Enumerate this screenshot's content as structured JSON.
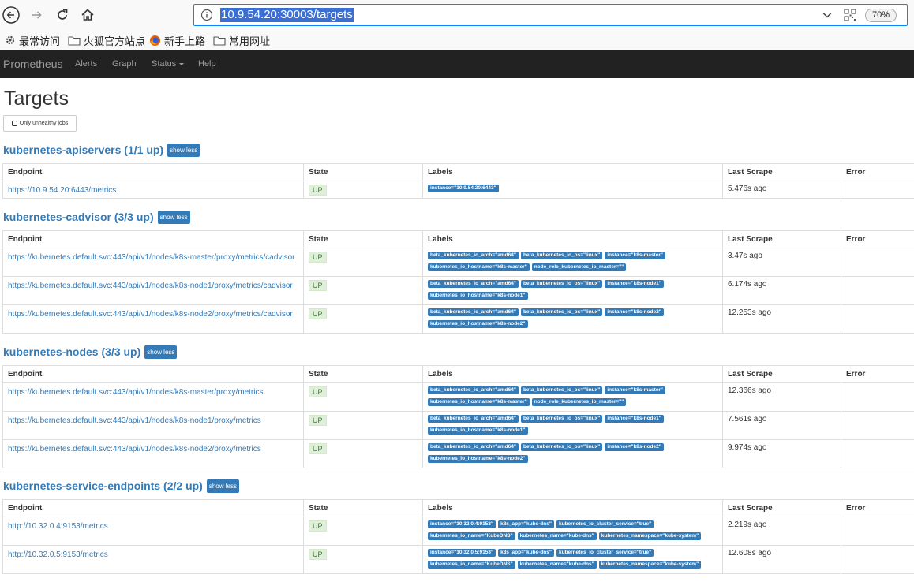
{
  "browser": {
    "url": "10.9.54.20:30003/targets",
    "zoom": "70%",
    "bookmarks": [
      "最常访问",
      "火狐官方站点",
      "新手上路",
      "常用网址"
    ]
  },
  "nav": {
    "brand": "Prometheus",
    "links": [
      "Alerts",
      "Graph",
      "Status",
      "Help"
    ]
  },
  "page": {
    "title": "Targets",
    "unhealthy_btn": "Only unhealthy jobs",
    "columns": [
      "Endpoint",
      "State",
      "Labels",
      "Last Scrape",
      "Error"
    ]
  },
  "jobs": [
    {
      "name": "kubernetes-apiservers (1/1 up)",
      "toggle": "show less",
      "targets": [
        {
          "endpoint": "https://10.9.54.20:6443/metrics",
          "state": "UP",
          "labels": [
            "instance=\"10.9.54.20:6443\""
          ],
          "last_scrape": "5.476s ago",
          "error": ""
        }
      ]
    },
    {
      "name": "kubernetes-cadvisor (3/3 up)",
      "toggle": "show less",
      "targets": [
        {
          "endpoint": "https://kubernetes.default.svc:443/api/v1/nodes/k8s-master/proxy/metrics/cadvisor",
          "state": "UP",
          "labels": [
            "beta_kubernetes_io_arch=\"amd64\"",
            "beta_kubernetes_io_os=\"linux\"",
            "instance=\"k8s-master\"",
            "kubernetes_io_hostname=\"k8s-master\"",
            "node_role_kubernetes_io_master=\"\""
          ],
          "last_scrape": "3.47s ago",
          "error": ""
        },
        {
          "endpoint": "https://kubernetes.default.svc:443/api/v1/nodes/k8s-node1/proxy/metrics/cadvisor",
          "state": "UP",
          "labels": [
            "beta_kubernetes_io_arch=\"amd64\"",
            "beta_kubernetes_io_os=\"linux\"",
            "instance=\"k8s-node1\"",
            "kubernetes_io_hostname=\"k8s-node1\""
          ],
          "last_scrape": "6.174s ago",
          "error": ""
        },
        {
          "endpoint": "https://kubernetes.default.svc:443/api/v1/nodes/k8s-node2/proxy/metrics/cadvisor",
          "state": "UP",
          "labels": [
            "beta_kubernetes_io_arch=\"amd64\"",
            "beta_kubernetes_io_os=\"linux\"",
            "instance=\"k8s-node2\"",
            "kubernetes_io_hostname=\"k8s-node2\""
          ],
          "last_scrape": "12.253s ago",
          "error": ""
        }
      ]
    },
    {
      "name": "kubernetes-nodes (3/3 up)",
      "toggle": "show less",
      "targets": [
        {
          "endpoint": "https://kubernetes.default.svc:443/api/v1/nodes/k8s-master/proxy/metrics",
          "state": "UP",
          "labels": [
            "beta_kubernetes_io_arch=\"amd64\"",
            "beta_kubernetes_io_os=\"linux\"",
            "instance=\"k8s-master\"",
            "kubernetes_io_hostname=\"k8s-master\"",
            "node_role_kubernetes_io_master=\"\""
          ],
          "last_scrape": "12.366s ago",
          "error": ""
        },
        {
          "endpoint": "https://kubernetes.default.svc:443/api/v1/nodes/k8s-node1/proxy/metrics",
          "state": "UP",
          "labels": [
            "beta_kubernetes_io_arch=\"amd64\"",
            "beta_kubernetes_io_os=\"linux\"",
            "instance=\"k8s-node1\"",
            "kubernetes_io_hostname=\"k8s-node1\""
          ],
          "last_scrape": "7.561s ago",
          "error": ""
        },
        {
          "endpoint": "https://kubernetes.default.svc:443/api/v1/nodes/k8s-node2/proxy/metrics",
          "state": "UP",
          "labels": [
            "beta_kubernetes_io_arch=\"amd64\"",
            "beta_kubernetes_io_os=\"linux\"",
            "instance=\"k8s-node2\"",
            "kubernetes_io_hostname=\"k8s-node2\""
          ],
          "last_scrape": "9.974s ago",
          "error": ""
        }
      ]
    },
    {
      "name": "kubernetes-service-endpoints (2/2 up)",
      "toggle": "show less",
      "targets": [
        {
          "endpoint": "http://10.32.0.4:9153/metrics",
          "state": "UP",
          "labels": [
            "instance=\"10.32.0.4:9153\"",
            "k8s_app=\"kube-dns\"",
            "kubernetes_io_cluster_service=\"true\"",
            "kubernetes_io_name=\"KubeDNS\"",
            "kubernetes_name=\"kube-dns\"",
            "kubernetes_namespace=\"kube-system\""
          ],
          "last_scrape": "2.219s ago",
          "error": ""
        },
        {
          "endpoint": "http://10.32.0.5:9153/metrics",
          "state": "UP",
          "labels": [
            "instance=\"10.32.0.5:9153\"",
            "k8s_app=\"kube-dns\"",
            "kubernetes_io_cluster_service=\"true\"",
            "kubernetes_io_name=\"KubeDNS\"",
            "kubernetes_name=\"kube-dns\"",
            "kubernetes_namespace=\"kube-system\""
          ],
          "last_scrape": "12.608s ago",
          "error": ""
        }
      ]
    }
  ]
}
